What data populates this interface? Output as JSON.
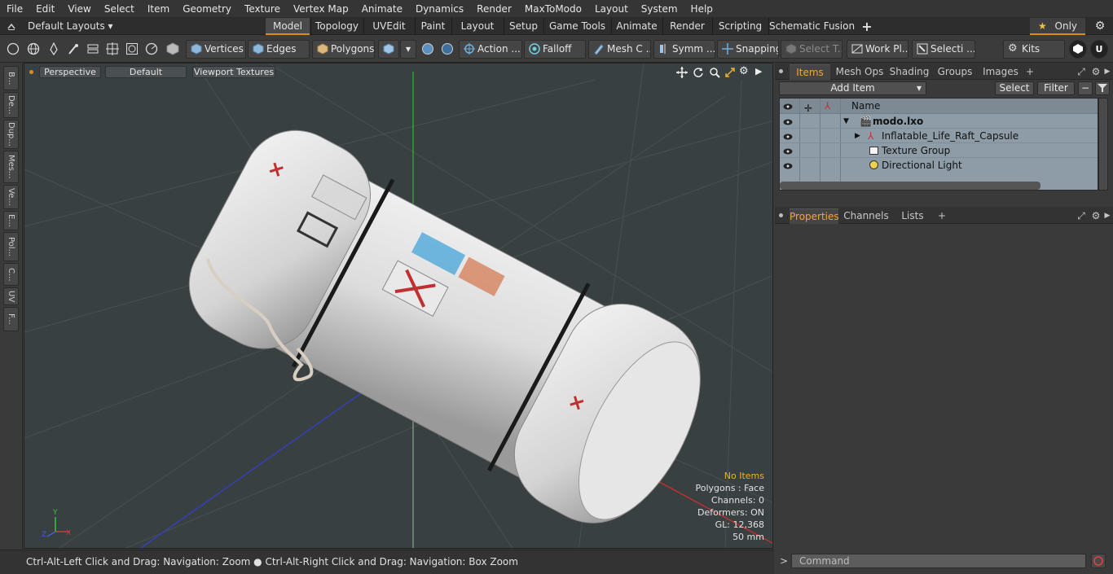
{
  "menu": [
    "File",
    "Edit",
    "View",
    "Select",
    "Item",
    "Geometry",
    "Texture",
    "Vertex Map",
    "Animate",
    "Dynamics",
    "Render",
    "MaxToModo",
    "Layout",
    "System",
    "Help"
  ],
  "layout_selector": {
    "label": "Default Layouts ▾"
  },
  "layout_tabs": [
    "Model",
    "Topology",
    "UVEdit",
    "Paint",
    "Layout",
    "Setup",
    "Game Tools",
    "Animate",
    "Render",
    "Scripting",
    "Schematic Fusion"
  ],
  "layout_tabs_active": "Model",
  "only_label": "Only",
  "toolbar": {
    "vertices": "Vertices",
    "edges": "Edges",
    "polygons": "Polygons",
    "action": "Action",
    "falloff": "Falloff",
    "mesh": "Mesh C ...",
    "symmetry": "Symm ...",
    "snapping": "Snapping",
    "select_tool": "Select T...",
    "work_plane": "Work Pl...",
    "selection": "Selecti ...",
    "kits": "Kits"
  },
  "left_tabs": [
    "B...",
    "De...",
    "Dup...",
    "Mes...",
    "Ve...",
    "E...",
    "Pol...",
    "C...",
    "UV",
    "F..."
  ],
  "viewport": {
    "perspective": "Perspective",
    "default": "Default",
    "textures": "Viewport Textures",
    "info": {
      "no_items": "No Items",
      "polygons": "Polygons : Face",
      "channels": "Channels: 0",
      "deformers": "Deformers: ON",
      "gl": "GL: 12,368",
      "scale": "50 mm"
    }
  },
  "status_text": "Ctrl-Alt-Left Click and Drag: Navigation: Zoom ● Ctrl-Alt-Right Click and Drag: Navigation: Box Zoom",
  "items_panel": {
    "tabs": [
      "Items",
      "Mesh Ops",
      "Shading",
      "Groups",
      "Images"
    ],
    "active": "Items",
    "add_item": "Add Item",
    "select": "Select",
    "filter": "Filter",
    "name_header": "Name",
    "rows": [
      "modo.lxo",
      "Inflatable_Life_Raft_Capsule",
      "Texture Group",
      "Directional Light"
    ]
  },
  "props_panel": {
    "tabs": [
      "Properties",
      "Channels",
      "Lists"
    ],
    "active": "Properties"
  },
  "command": {
    "placeholder": "Command",
    "prompt": ">"
  },
  "colors": {
    "accent": "#e08a1e",
    "active_tab_text": "#f0a63a",
    "viewport_bg": "#394042",
    "list_bg": "#8d9ca6"
  }
}
